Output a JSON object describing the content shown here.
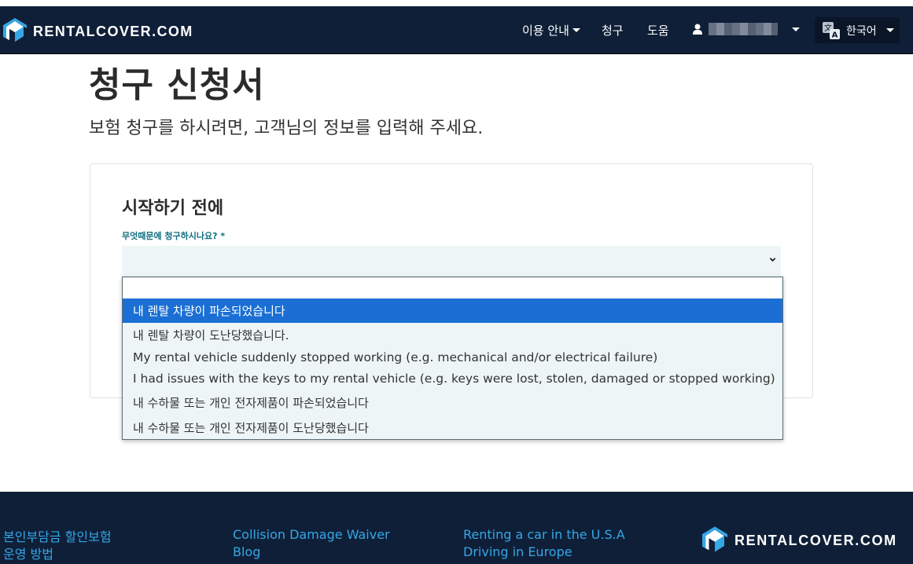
{
  "brand": {
    "name": "RENTALCOVER.COM",
    "accent": "#35a7e6",
    "navy": "#0f1f38"
  },
  "nav": {
    "guide_label": "이용 안내",
    "claims_label": "청구",
    "help_label": "도움",
    "language_label": "한국어"
  },
  "page": {
    "title": "청구 신청서",
    "subtitle": "보험 청구를 하시려면, 고객님의 정보를 입력해 주세요."
  },
  "form": {
    "section_title": "시작하기 전에",
    "reason_label": "무엇때문에 청구하시나요? *",
    "reason_value": "",
    "options": [
      "내 렌탈 차량이 파손되었습니다",
      "내 렌탈 차량이 도난당했습니다.",
      "My rental vehicle suddenly stopped working (e.g. mechanical and/or electrical failure)",
      "I had issues with the keys to my rental vehicle (e.g. keys were lost, stolen, damaged or stopped working)",
      "내 수하물 또는 개인 전자제품이 파손되었습니다",
      "내 수하물 또는 개인 전자제품이 도난당했습니다"
    ],
    "highlighted_option_index": 0
  },
  "footer": {
    "col1": [
      "본인부담금 할인보험",
      "운영 방법"
    ],
    "col2": [
      "Collision Damage Waiver",
      "Blog"
    ],
    "col3": [
      "Renting a car in the U.S.A",
      "Driving in Europe"
    ]
  }
}
